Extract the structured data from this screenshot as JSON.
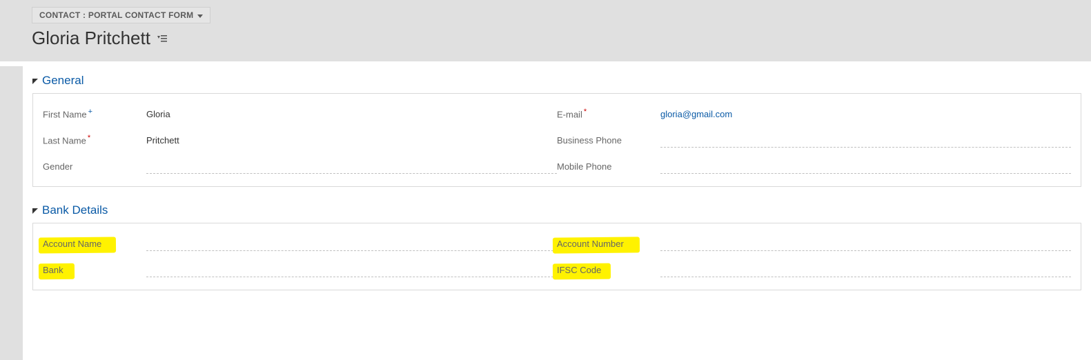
{
  "header": {
    "form_selector": "CONTACT : PORTAL CONTACT FORM",
    "record_name": "Gloria Pritchett"
  },
  "sections": {
    "general": {
      "title": "General",
      "fields": {
        "first_name": {
          "label": "First Name",
          "value": "Gloria"
        },
        "last_name": {
          "label": "Last Name",
          "value": "Pritchett"
        },
        "gender": {
          "label": "Gender",
          "value": ""
        },
        "email": {
          "label": "E-mail",
          "value": "gloria@gmail.com"
        },
        "business_phone": {
          "label": "Business Phone",
          "value": ""
        },
        "mobile_phone": {
          "label": "Mobile Phone",
          "value": ""
        }
      }
    },
    "bank": {
      "title": "Bank Details",
      "fields": {
        "account_name": {
          "label": "Account Name",
          "value": ""
        },
        "bank": {
          "label": "Bank",
          "value": ""
        },
        "account_number": {
          "label": "Account Number",
          "value": ""
        },
        "ifsc": {
          "label": "IFSC Code",
          "value": ""
        }
      }
    }
  }
}
